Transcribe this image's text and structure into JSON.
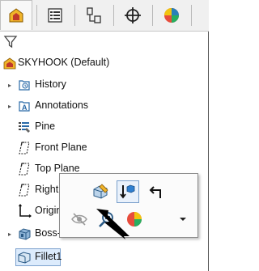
{
  "tabs": [
    {
      "name": "feature-manager-tab",
      "icon": "feature-manager-icon"
    },
    {
      "name": "property-manager-tab",
      "icon": "property-manager-icon"
    },
    {
      "name": "configuration-manager-tab",
      "icon": "configuration-manager-icon"
    },
    {
      "name": "dimxpert-manager-tab",
      "icon": "crosshair-icon"
    },
    {
      "name": "display-manager-tab",
      "icon": "display-manager-icon"
    }
  ],
  "filter": {
    "icon": "filter-icon"
  },
  "tree": {
    "root_label": "SKYHOOK  (Default)",
    "items": [
      {
        "label": "History",
        "icon": "history-icon",
        "expandable": true
      },
      {
        "label": "Annotations",
        "icon": "annotations-icon",
        "expandable": true
      },
      {
        "label": "Pine",
        "icon": "material-icon",
        "expandable": false
      },
      {
        "label": "Front Plane",
        "icon": "plane-icon",
        "expandable": false
      },
      {
        "label": "Top Plane",
        "icon": "plane-icon",
        "expandable": false
      },
      {
        "label": "Right",
        "icon": "plane-icon",
        "expandable": false
      },
      {
        "label": "Origin",
        "icon": "origin-icon",
        "expandable": false
      },
      {
        "label": "Boss-",
        "icon": "boss-extrude-icon",
        "expandable": true
      },
      {
        "label": "Fillet1",
        "icon": "fillet-icon",
        "expandable": false,
        "selected": true
      }
    ]
  },
  "context_toolbar": {
    "buttons": [
      {
        "name": "edit-feature-button",
        "icon": "edit-feature-icon"
      },
      {
        "name": "rollback-button",
        "icon": "rollback-icon",
        "highlighted": true
      },
      {
        "name": "edit-sketch-button",
        "icon": "return-arrow-icon"
      },
      {
        "name": "hide-button",
        "icon": "hide-eye-icon"
      },
      {
        "name": "zoom-to-selection-button",
        "icon": "zoom-icon"
      },
      {
        "name": "appearance-button",
        "icon": "appearance-icon"
      },
      {
        "name": "more-dropdown-button",
        "icon": "chevron-down-icon"
      }
    ]
  },
  "colors": {
    "accent_orange": "#e8a317",
    "selection_blue": "#dcebfc"
  }
}
